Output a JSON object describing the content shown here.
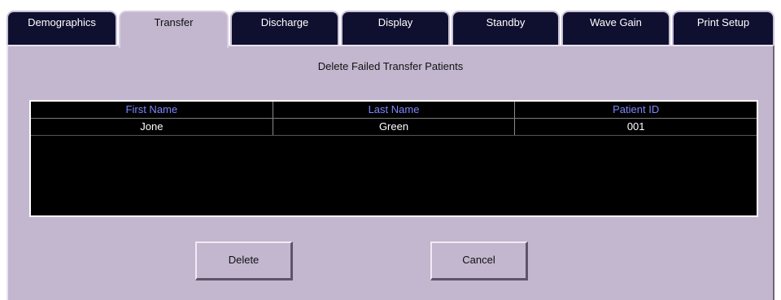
{
  "tabs": [
    {
      "label": "Demographics",
      "active": false
    },
    {
      "label": "Transfer",
      "active": true
    },
    {
      "label": "Discharge",
      "active": false
    },
    {
      "label": "Display",
      "active": false
    },
    {
      "label": "Standby",
      "active": false
    },
    {
      "label": "Wave Gain",
      "active": false
    },
    {
      "label": "Print Setup",
      "active": false
    }
  ],
  "panel": {
    "title": "Delete Failed Transfer Patients"
  },
  "table": {
    "columns": [
      "First Name",
      "Last Name",
      "Patient ID"
    ],
    "rows": [
      [
        "Jone",
        "Green",
        "001"
      ]
    ]
  },
  "buttons": {
    "delete": "Delete",
    "cancel": "Cancel"
  },
  "colors": {
    "panel_background": "#c3b7cf",
    "tab_background": "#0f0f2f",
    "table_background": "#000000",
    "header_text": "#7d86ff"
  }
}
